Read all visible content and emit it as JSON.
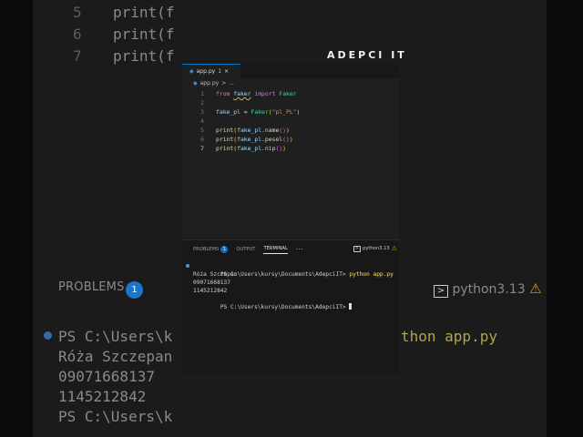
{
  "background": {
    "lines": [
      {
        "num": "5",
        "code": "print(f"
      },
      {
        "num": "6",
        "code": "print(f"
      },
      {
        "num": "7",
        "code": "print(f"
      }
    ],
    "problems_label": "PROBLEMS",
    "problems_count": "1",
    "python_version": "python3.13",
    "terminal_lines": [
      "PS C:\\Users\\k",
      "Róża Szczepan",
      "09071668137",
      "1145212842",
      "PS C:\\Users\\k"
    ],
    "command_fragment": "thon app.py"
  },
  "watermark": "ADEPCI IT",
  "editor": {
    "tab": {
      "filename": "app.py",
      "problems": "1",
      "close": "×"
    },
    "breadcrumb": {
      "file": "app.py",
      "separator": ">",
      "rest": "..."
    },
    "code": [
      {
        "num": "1",
        "parts": [
          [
            "kw",
            "from "
          ],
          [
            "var",
            "faker"
          ],
          [
            "kw",
            " import "
          ],
          [
            "cls",
            "Faker"
          ]
        ]
      },
      {
        "num": "2",
        "parts": []
      },
      {
        "num": "3",
        "parts": [
          [
            "var",
            "fake_pl"
          ],
          [
            "plain",
            " = "
          ],
          [
            "cls",
            "Faker"
          ],
          [
            "p1",
            "("
          ],
          [
            "str",
            "\"pl_PL\""
          ],
          [
            "p1",
            ")"
          ]
        ]
      },
      {
        "num": "4",
        "parts": []
      },
      {
        "num": "5",
        "parts": [
          [
            "fn",
            "print"
          ],
          [
            "p1",
            "("
          ],
          [
            "var",
            "fake_pl"
          ],
          [
            "plain",
            "."
          ],
          [
            "fn",
            "name"
          ],
          [
            "p2",
            "()"
          ],
          [
            "p1",
            ")"
          ]
        ]
      },
      {
        "num": "6",
        "parts": [
          [
            "fn",
            "print"
          ],
          [
            "p1",
            "("
          ],
          [
            "var",
            "fake_pl"
          ],
          [
            "plain",
            "."
          ],
          [
            "fn",
            "pesel"
          ],
          [
            "p2",
            "()"
          ],
          [
            "p1",
            ")"
          ]
        ]
      },
      {
        "num": "7",
        "parts": [
          [
            "fn",
            "print"
          ],
          [
            "p1",
            "("
          ],
          [
            "var",
            "fake_pl"
          ],
          [
            "plain",
            "."
          ],
          [
            "fn",
            "nip"
          ],
          [
            "p2",
            "()"
          ],
          [
            "p1",
            ")"
          ]
        ]
      }
    ],
    "active_line": "7"
  },
  "panel": {
    "tabs": [
      {
        "label": "PROBLEMS",
        "badge": "1",
        "active": false
      },
      {
        "label": "OUTPUT",
        "active": false
      },
      {
        "label": "TERMINAL",
        "active": true
      }
    ],
    "more": "···",
    "python_env": "python3.13",
    "terminal": {
      "prompt": "PS C:\\Users\\kursy\\Documents\\AdepciIT>",
      "command": "python app.py",
      "output": [
        "Róża Szczepan",
        "09071668137",
        "1145212842"
      ],
      "prompt2": "PS C:\\Users\\kursy\\Documents\\AdepciIT>"
    }
  },
  "colors": {
    "accent": "#0078d4",
    "keyword": "#c586c0",
    "variable": "#9cdcfe",
    "class": "#4ec9b0",
    "function": "#dcdcaa",
    "string": "#ce9178",
    "command": "#ffe566"
  }
}
